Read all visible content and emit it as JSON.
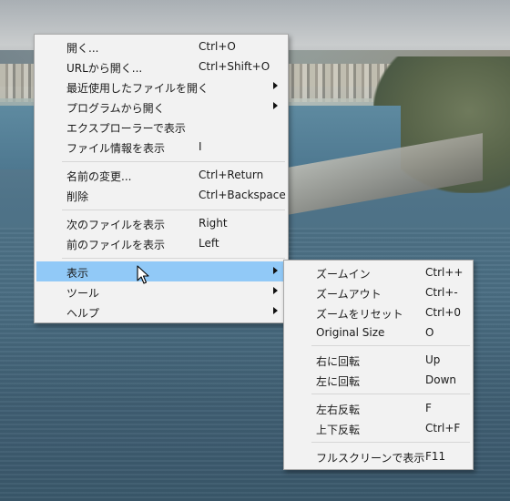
{
  "main_menu": {
    "items": [
      {
        "label": "開く...",
        "accel": "Ctrl+O",
        "submenu": false
      },
      {
        "label": "URLから開く...",
        "accel": "Ctrl+Shift+O",
        "submenu": false
      },
      {
        "label": "最近使用したファイルを開く",
        "accel": "",
        "submenu": true
      },
      {
        "label": "プログラムから開く",
        "accel": "",
        "submenu": true
      },
      {
        "label": "エクスプローラーで表示",
        "accel": "",
        "submenu": false
      },
      {
        "label": "ファイル情報を表示",
        "accel": "I",
        "submenu": false
      },
      {
        "label": "名前の変更...",
        "accel": "Ctrl+Return",
        "submenu": false
      },
      {
        "label": "削除",
        "accel": "Ctrl+Backspace",
        "submenu": false
      },
      {
        "label": "次のファイルを表示",
        "accel": "Right",
        "submenu": false
      },
      {
        "label": "前のファイルを表示",
        "accel": "Left",
        "submenu": false
      },
      {
        "label": "表示",
        "accel": "",
        "submenu": true,
        "highlighted": true
      },
      {
        "label": "ツール",
        "accel": "",
        "submenu": true
      },
      {
        "label": "ヘルプ",
        "accel": "",
        "submenu": true
      }
    ]
  },
  "view_submenu": {
    "items": [
      {
        "label": "ズームイン",
        "accel": "Ctrl++"
      },
      {
        "label": "ズームアウト",
        "accel": "Ctrl+-"
      },
      {
        "label": "ズームをリセット",
        "accel": "Ctrl+0"
      },
      {
        "label": "Original Size",
        "accel": "O"
      },
      {
        "label": "右に回転",
        "accel": "Up"
      },
      {
        "label": "左に回転",
        "accel": "Down"
      },
      {
        "label": "左右反転",
        "accel": "F"
      },
      {
        "label": "上下反転",
        "accel": "Ctrl+F"
      },
      {
        "label": "フルスクリーンで表示",
        "accel": "F11"
      }
    ]
  },
  "colors": {
    "menu_bg": "#f2f2f2",
    "highlight": "#91c9f7",
    "separator": "#d6d6d6"
  },
  "icons": {
    "cursor": "arrow-cursor-icon",
    "submenu_arrow": "chevron-right-icon"
  }
}
